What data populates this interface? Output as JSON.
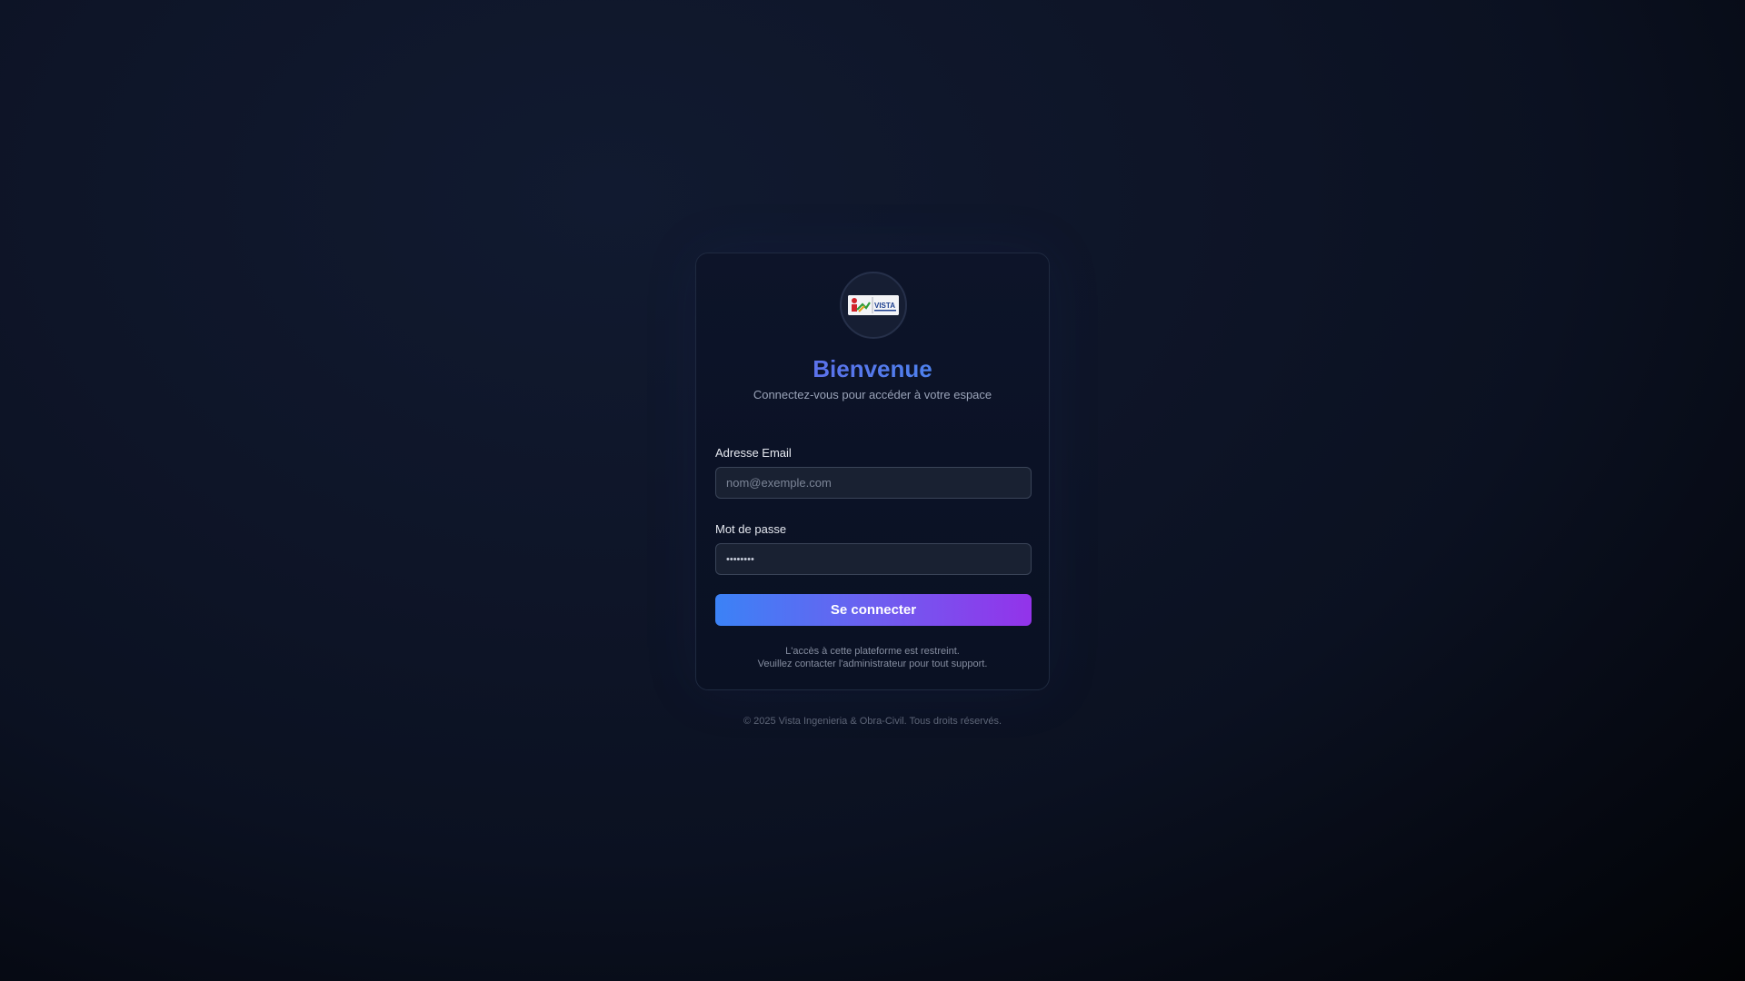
{
  "brand": {
    "logo_icon": "vista-logo",
    "logo_text": "VISTA"
  },
  "header": {
    "title": "Bienvenue",
    "subtitle": "Connectez-vous pour accéder à votre espace"
  },
  "form": {
    "email": {
      "label": "Adresse Email",
      "placeholder": "nom@exemple.com",
      "value": ""
    },
    "password": {
      "label": "Mot de passe",
      "value": "••••••••"
    },
    "submit_label": "Se connecter"
  },
  "notice": {
    "line1": "L'accès à cette plateforme est restreint.",
    "line2": "Veuillez contacter l'administrateur pour tout support."
  },
  "footer": {
    "copyright": "© 2025 Vista Ingenieria & Obra-Civil. Tous droits réservés."
  },
  "colors": {
    "accent_start": "#3b82f6",
    "accent_end": "#9333ea",
    "title_start": "#6a63e8",
    "title_end": "#3f8ff0",
    "background": "#0e1528"
  }
}
